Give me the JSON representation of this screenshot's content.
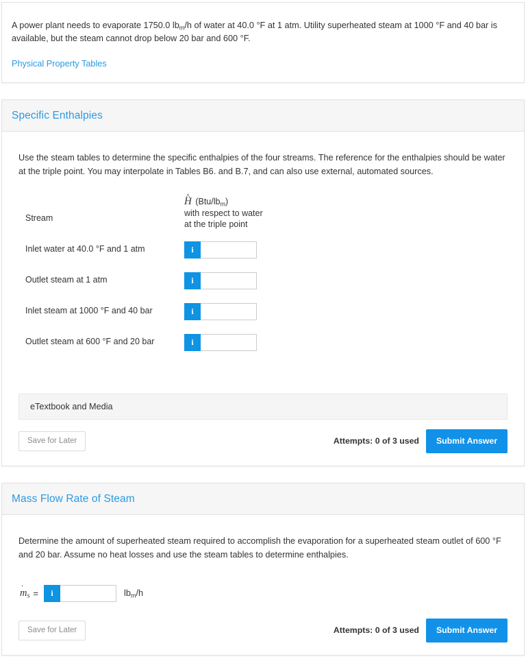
{
  "colors": {
    "accent_blue": "#2a9ae1",
    "button_blue": "#1192e8",
    "info_blue": "#0f93e3",
    "header_gray": "#f6f6f6",
    "text": "#333333",
    "muted": "#8d8d8d"
  },
  "prompt": {
    "sentence_part_1": "A power plant needs to evaporate 1750.0 lb",
    "sub_1": "m",
    "sentence_part_2": "/h of water at 40.0 °F at 1 atm. Utility superheated steam at 1000 °F and 40 bar is available, but the steam cannot drop below 20 bar and 600 °F.",
    "link_label": "Physical Property Tables"
  },
  "enthalpies_card": {
    "title": "Specific Enthalpies",
    "instructions": "Use the steam tables to determine the specific enthalpies of the four streams. The reference for the enthalpies should be water at the triple point. You may interpolate in Tables B6. and B.7, and can also use external, automated sources.",
    "table": {
      "header_stream": "Stream",
      "header_symbol": "H",
      "header_symbol_accent": "^",
      "header_units_prefix": "(Btu/lb",
      "header_units_sub": "m",
      "header_units_suffix": ")",
      "header_line2": "with respect to water",
      "header_line3": "at the triple point",
      "rows": [
        {
          "label": "Inlet water at 40.0 °F and 1 atm",
          "value": "",
          "info_label": "i"
        },
        {
          "label": "Outlet steam at 1 atm",
          "value": "",
          "info_label": "i"
        },
        {
          "label": "Inlet steam at 1000 °F and 40 bar",
          "value": "",
          "info_label": "i"
        },
        {
          "label": "Outlet steam at 600 °F and 20 bar",
          "value": "",
          "info_label": "i"
        }
      ]
    },
    "etextbook_label": "eTextbook and Media",
    "save_label": "Save for Later",
    "attempts_label": "Attempts: 0 of 3 used",
    "submit_label": "Submit Answer"
  },
  "mass_flow_card": {
    "title": "Mass Flow Rate of Steam",
    "instructions": "Determine the amount of superheated steam required to accomplish the evaporation for a superheated steam outlet of 600 °F and 20 bar. Assume no heat losses and use the steam tables to determine enthalpies.",
    "symbol_base": "m",
    "symbol_dot": "˙",
    "symbol_sub": "s",
    "equals": "=",
    "info_label": "i",
    "value": "",
    "units_prefix": "lb",
    "units_sub": "m",
    "units_suffix": "/h",
    "save_label": "Save for Later",
    "attempts_label": "Attempts: 0 of 3 used",
    "submit_label": "Submit Answer"
  }
}
